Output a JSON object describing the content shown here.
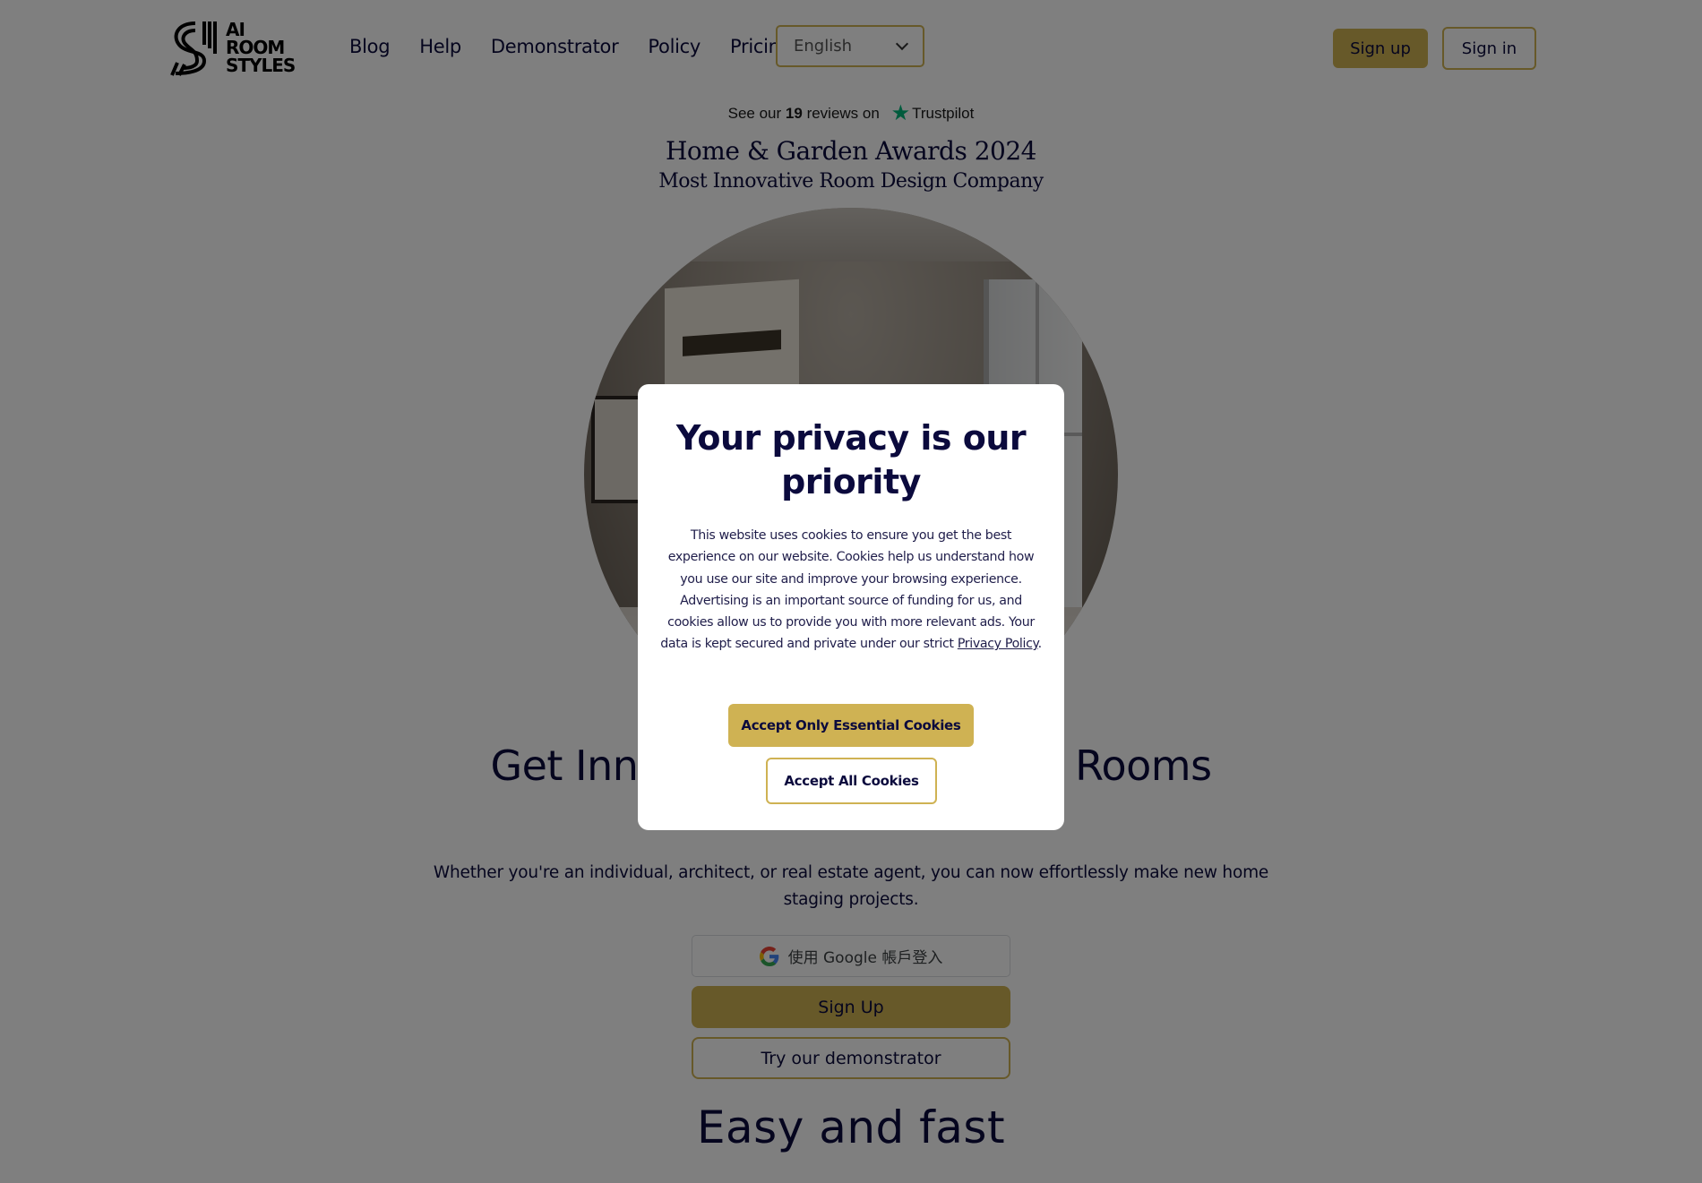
{
  "header": {
    "logo_lines": [
      "AI",
      "ROOM",
      "STYLES"
    ],
    "nav": [
      "Blog",
      "Help",
      "Demonstrator",
      "Policy",
      "Pricing"
    ],
    "language": {
      "selected": "English",
      "icon": "chevron-down-icon"
    },
    "signup_label": "Sign up",
    "signin_label": "Sign in"
  },
  "trustpilot": {
    "prefix": "See our",
    "count": "19",
    "middle": "reviews on",
    "brand": "Trustpilot",
    "icon": "star-icon",
    "brand_color": "#00b67a"
  },
  "award": {
    "title": "Home & Garden Awards 2024",
    "subtitle": "Most Innovative Room Design Company"
  },
  "hero": {
    "heading_visible_left": "Get Inno",
    "heading_visible_right": "Rooms",
    "intro": "Whether you're an individual, architect, or real estate agent, you can now effortlessly make new home staging projects.",
    "google_label": "使用 Google 帳戶登入",
    "signup_label": "Sign Up",
    "demo_label": "Try our demonstrator"
  },
  "section2": {
    "heading": "Easy and fast"
  },
  "cookie_modal": {
    "title": "Your privacy is our priority",
    "body": "This website uses cookies to ensure you get the best experience on our website. Cookies help us understand how you use our site and improve your browsing experience. Advertising is an important source of funding for us, and cookies allow us to provide you with more relevant ads. Your data is kept secured and private under our strict",
    "link_label": "Privacy Policy",
    "body_end": ".",
    "essential_label": "Accept Only Essential Cookies",
    "all_label": "Accept All Cookies"
  },
  "colors": {
    "accent": "#cfb253",
    "text": "#0b0a3d",
    "overlay": "rgba(0,0,0,0.5)"
  }
}
